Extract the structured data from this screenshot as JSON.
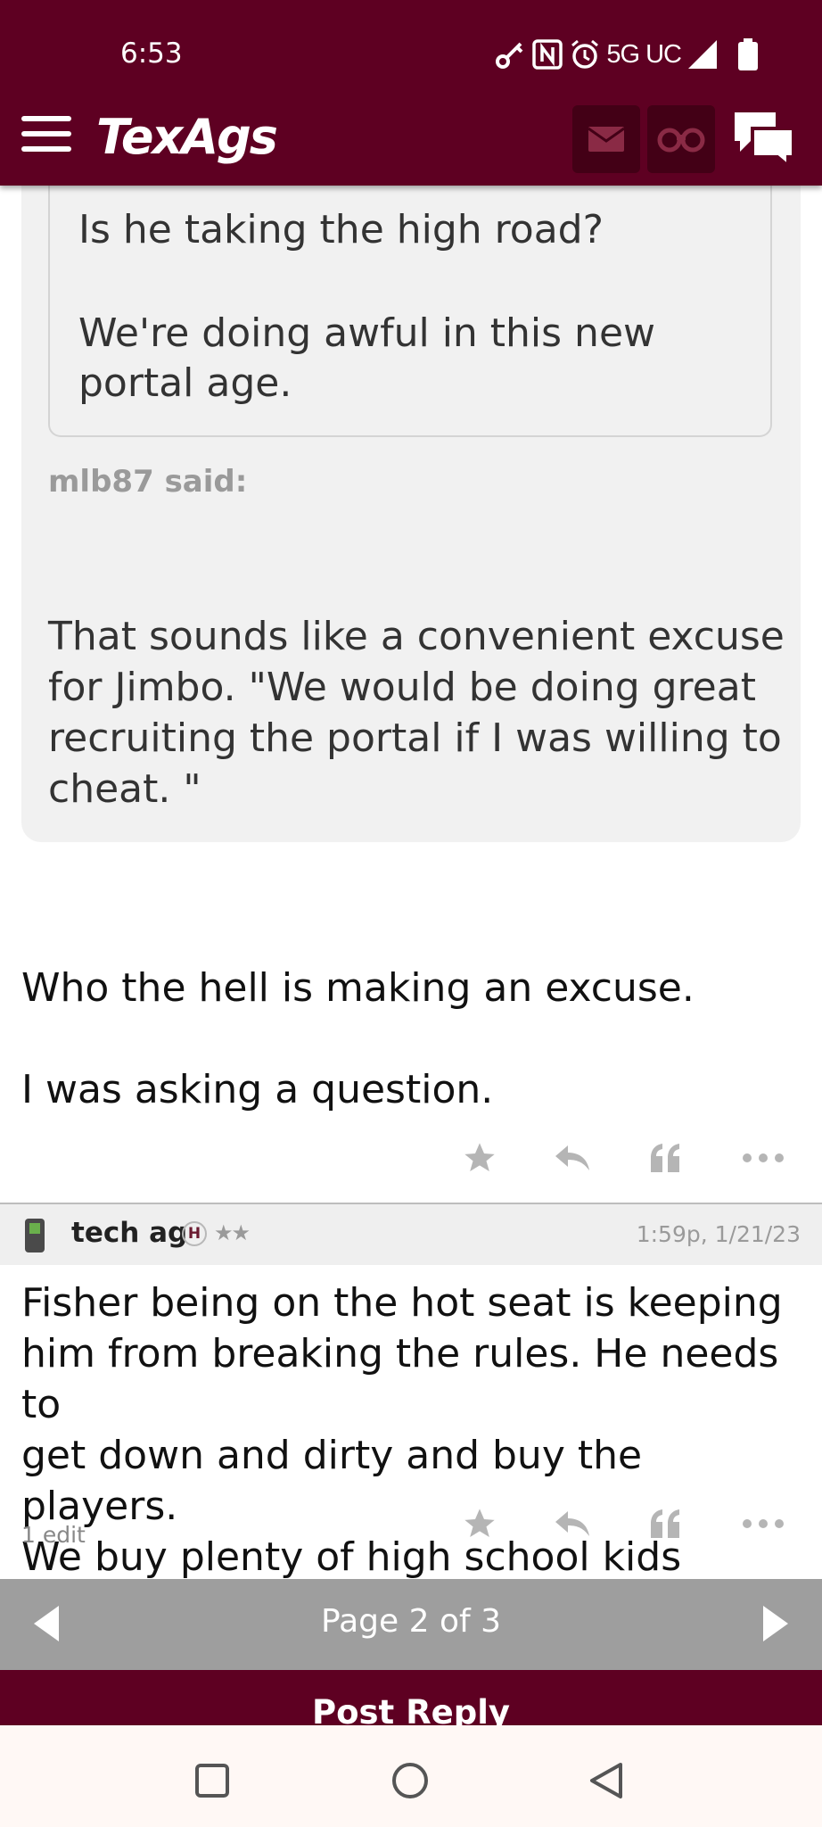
{
  "status_bar": {
    "time": "6:53",
    "network": "5G UC",
    "icons": [
      "key-icon",
      "nfc-icon",
      "alarm-icon",
      "signal-icon",
      "battery-icon"
    ]
  },
  "header": {
    "logo": "TexAgs",
    "menu_icon": "hamburger-menu-icon",
    "actions": [
      "mail-icon",
      "binoculars-icon",
      "chat-bubbles-icon"
    ]
  },
  "quote": {
    "inner_lines": [
      "Is he taking the high road?",
      "We're doing awful in this new",
      "portal age."
    ],
    "author_said": "mlb87 said:",
    "outer_lines": [
      "That sounds like a convenient excuse",
      "for Jimbo. \"We would be doing great",
      "recruiting the portal if I was willing to",
      "cheat. \""
    ]
  },
  "reply": {
    "lines": [
      "Who the hell is making an excuse.",
      "I was asking a question."
    ]
  },
  "post": {
    "username": "tech ag",
    "badge": "H",
    "stars": "★★",
    "timestamp": "1:59p, 1/21/23",
    "lines": [
      "Fisher being on the hot seat is keeping",
      "him from breaking the rules. He needs to",
      "get down and dirty and buy the players.",
      "We buy plenty of high school kids"
    ],
    "edit_note": "1 edit"
  },
  "pagination": {
    "label": "Page 2 of 3"
  },
  "post_reply": {
    "label": "Post Reply"
  },
  "colors": {
    "brand": "#5e0022",
    "icon_gray": "#b5b5b5",
    "pager": "#9e9e9e"
  }
}
